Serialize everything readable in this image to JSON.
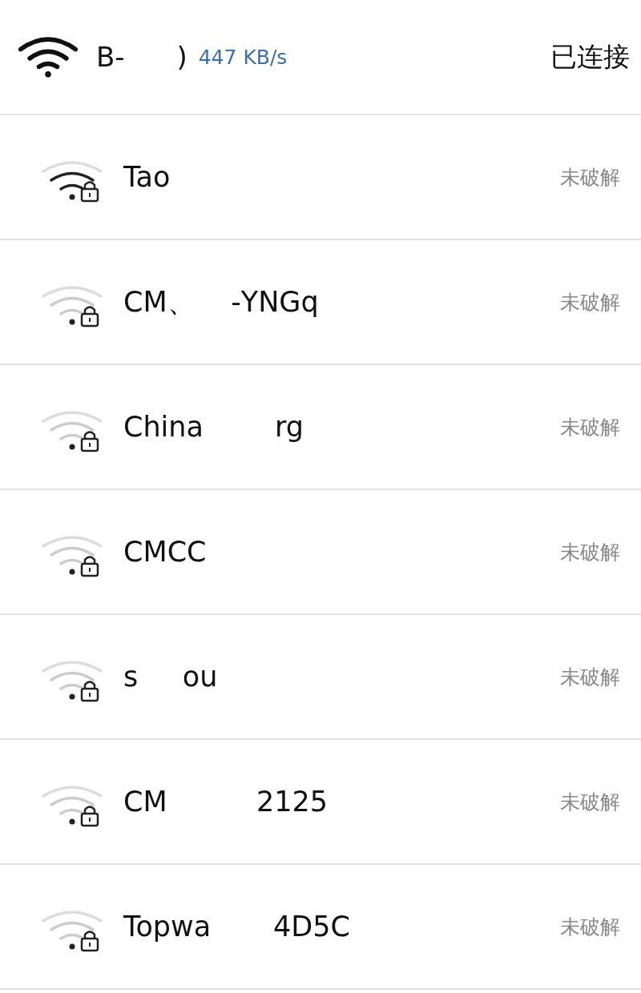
{
  "connected": {
    "name": "B-      )",
    "speed": "447 KB/s",
    "status": "已连接"
  },
  "networks": [
    {
      "name": "Tao",
      "kind": "strong",
      "locked": true,
      "status": "未破解"
    },
    {
      "name": "CM、    -YNGq",
      "kind": "weak",
      "locked": true,
      "status": "未破解"
    },
    {
      "name": "China        rg",
      "kind": "weak",
      "locked": true,
      "status": "未破解"
    },
    {
      "name": "CMCC",
      "kind": "weak",
      "locked": true,
      "status": "未破解"
    },
    {
      "name": "s     ou",
      "kind": "weak",
      "locked": true,
      "status": "未破解"
    },
    {
      "name": "CM          2125",
      "kind": "weak",
      "locked": true,
      "status": "未破解"
    },
    {
      "name": "Topwa       4D5C",
      "kind": "weak",
      "locked": true,
      "status": "未破解"
    }
  ]
}
